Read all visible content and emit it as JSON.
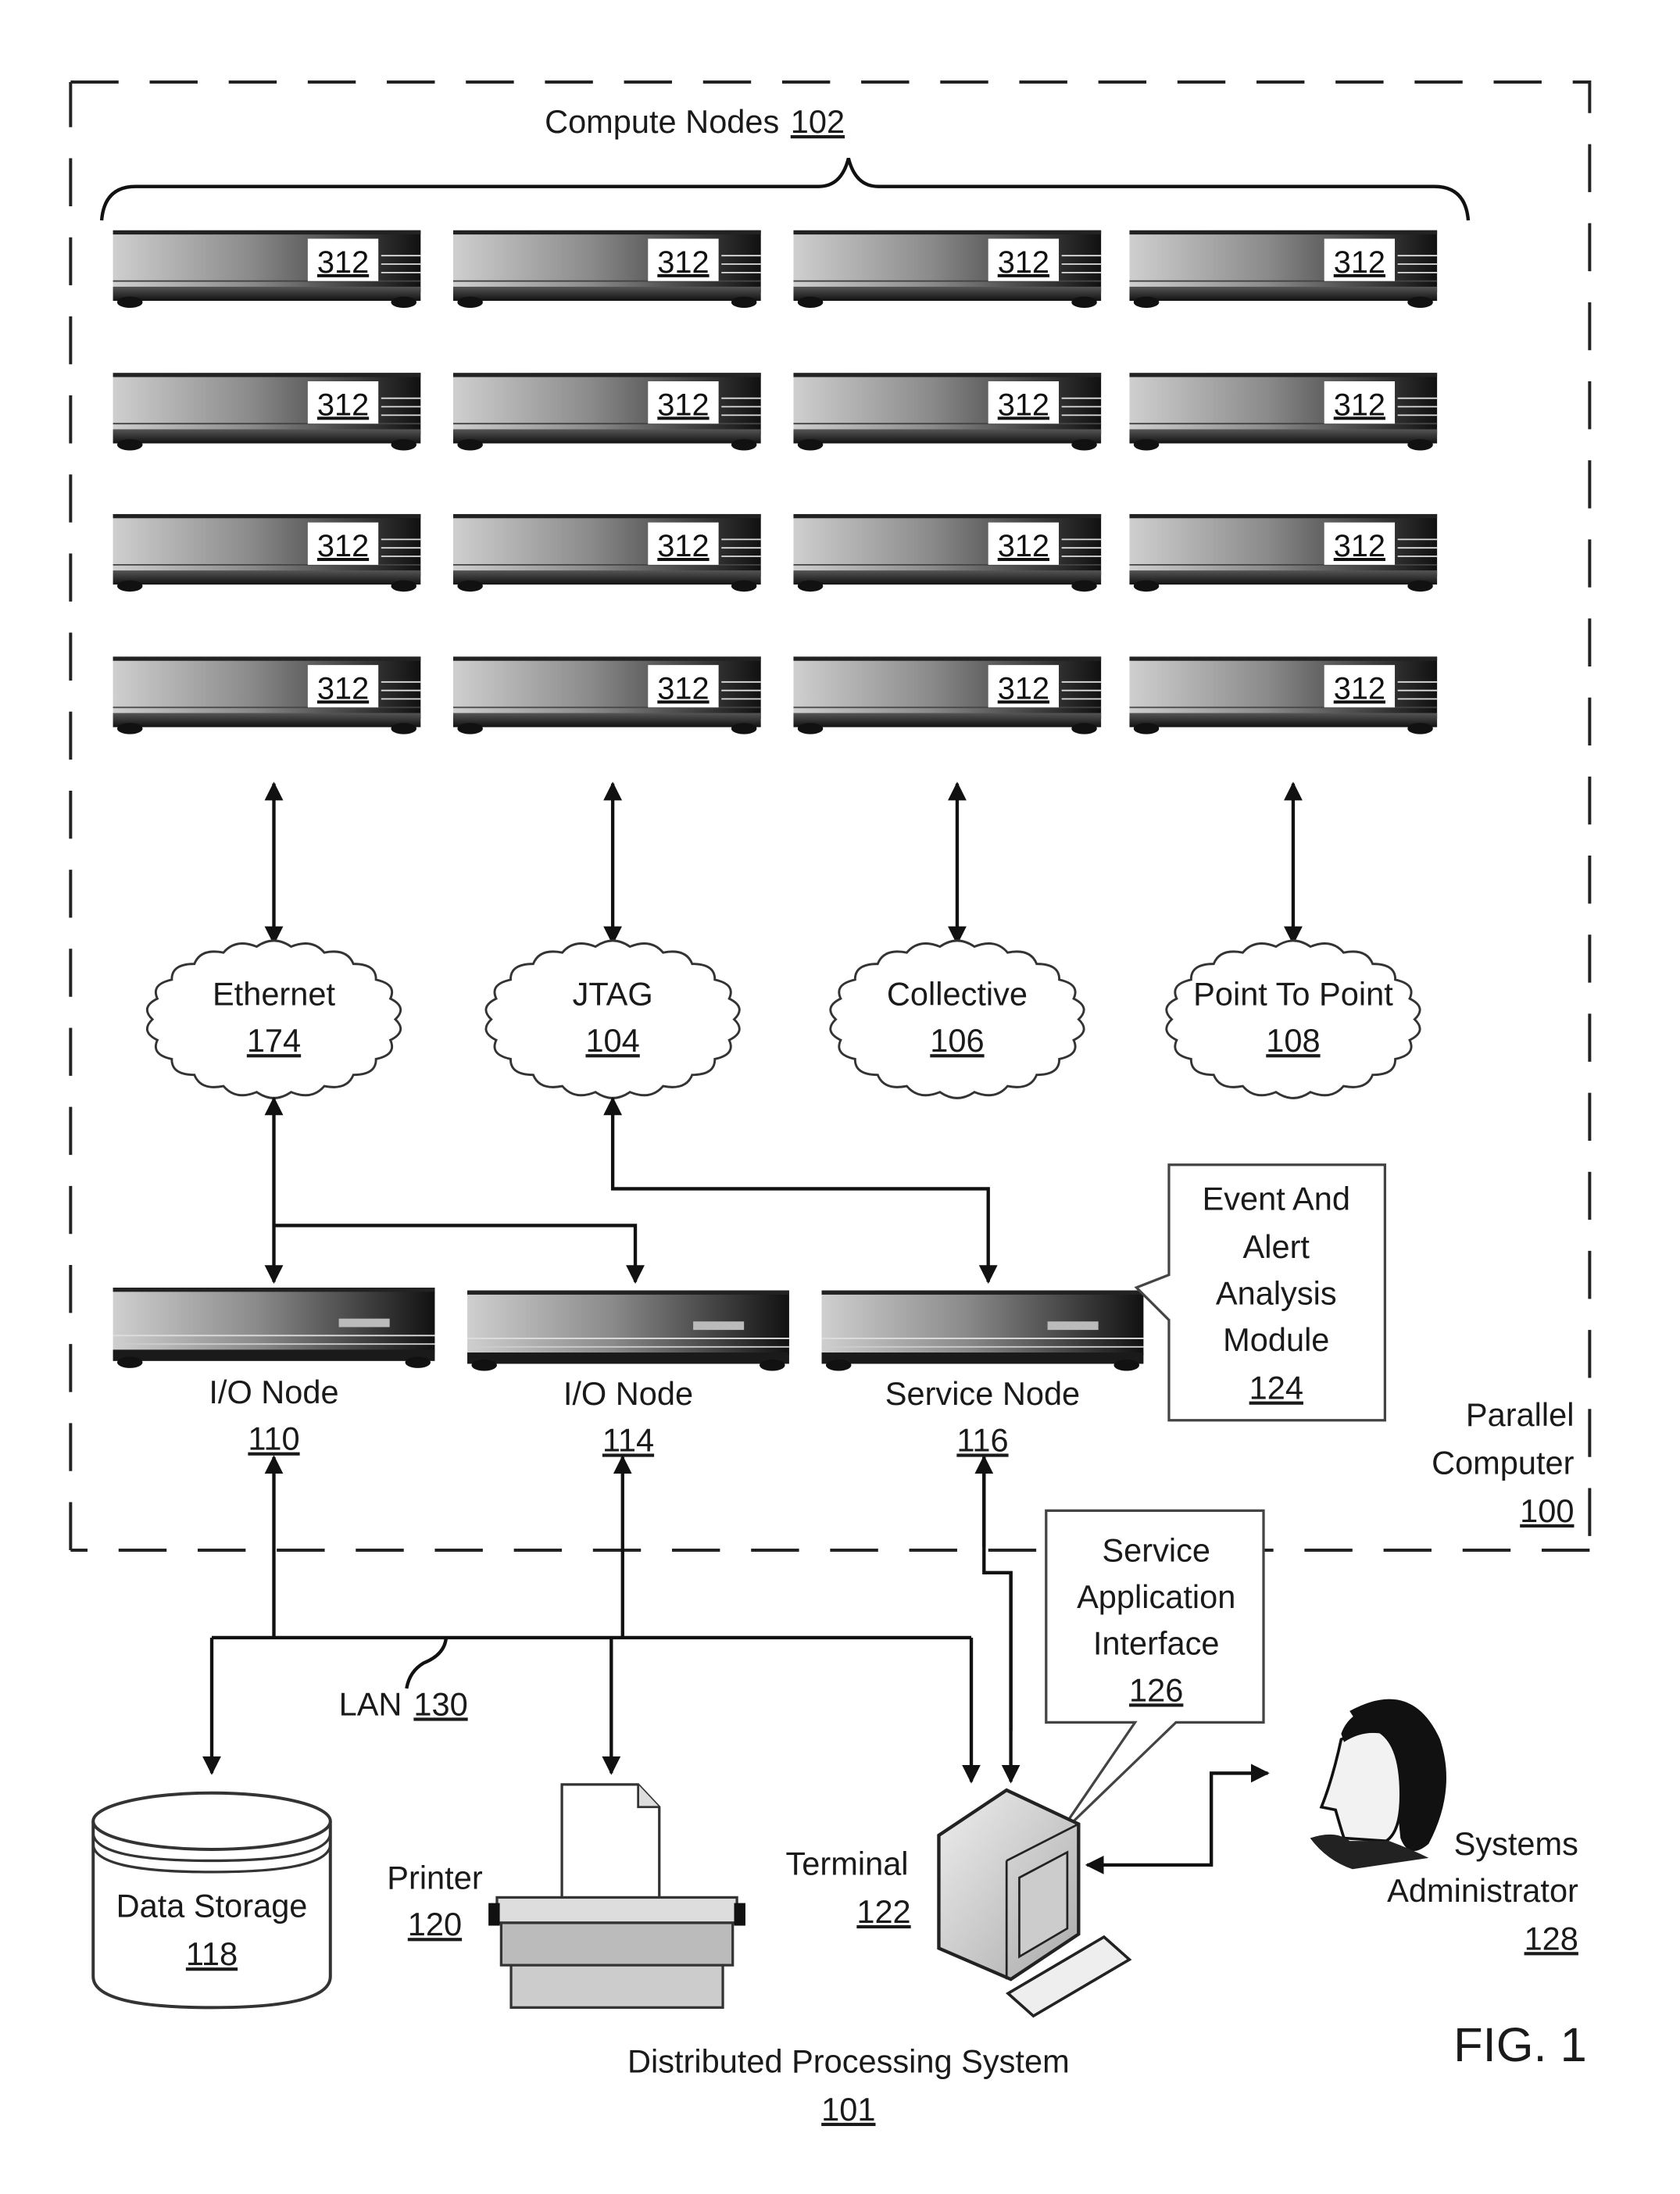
{
  "figure": {
    "label": "FIG. 1",
    "system": {
      "name": "Distributed Processing System",
      "ref": "101"
    },
    "parallel_computer": {
      "line1": "Parallel",
      "line2": "Computer",
      "ref": "100"
    }
  },
  "compute_nodes": {
    "label": "Compute Nodes",
    "ref": "102",
    "rows": 4,
    "cols": 4,
    "node_ref": "312"
  },
  "networks": [
    {
      "name": "Ethernet",
      "ref": "174"
    },
    {
      "name": "JTAG",
      "ref": "104"
    },
    {
      "name": "Collective",
      "ref": "106"
    },
    {
      "name": "Point To Point",
      "ref": "108"
    }
  ],
  "nodes": [
    {
      "name": "I/O Node",
      "ref": "110"
    },
    {
      "name": "I/O Node",
      "ref": "114"
    },
    {
      "name": "Service Node",
      "ref": "116"
    }
  ],
  "event_module": {
    "lines": [
      "Event And",
      "Alert",
      "Analysis",
      "Module"
    ],
    "ref": "124"
  },
  "service_app": {
    "lines": [
      "Service",
      "Application",
      "Interface"
    ],
    "ref": "126"
  },
  "lan": {
    "label": "LAN",
    "ref": "130"
  },
  "data_storage": {
    "name": "Data Storage",
    "ref": "118"
  },
  "printer": {
    "name": "Printer",
    "ref": "120"
  },
  "terminal": {
    "name": "Terminal",
    "ref": "122"
  },
  "admin": {
    "line1": "Systems",
    "line2": "Administrator",
    "ref": "128"
  }
}
